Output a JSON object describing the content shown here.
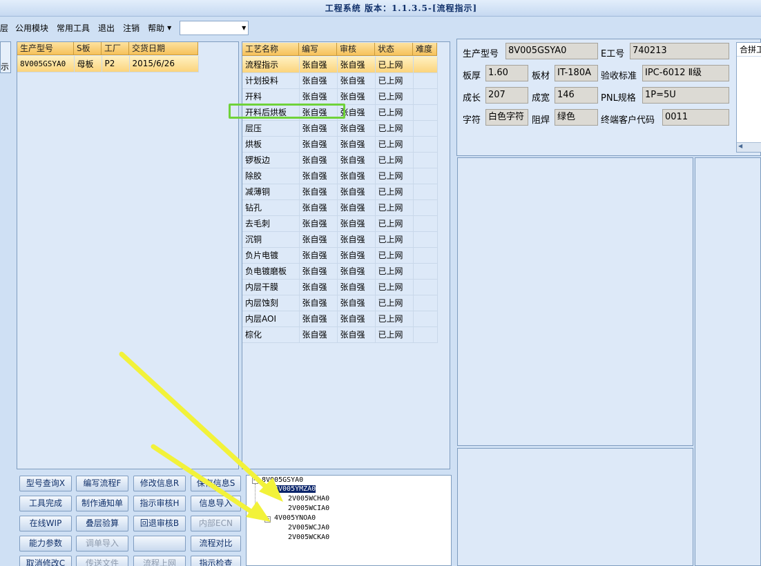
{
  "window": {
    "title": "工程系统 版本：1.1.3.5-[流程指示]"
  },
  "menu": {
    "items": [
      "公用模块",
      "常用工具",
      "退出",
      "注销",
      "帮助"
    ],
    "left_stub": "层",
    "combo_value": ""
  },
  "left_stub": {
    "label": "示"
  },
  "orders": {
    "headers": [
      "生产型号",
      "S板",
      "工厂",
      "交货日期"
    ],
    "rows": [
      [
        "8V005GSYA0",
        "母板",
        "P2",
        "2015/6/26"
      ]
    ]
  },
  "process": {
    "headers": [
      "工艺名称",
      "编写",
      "审核",
      "状态",
      "难度"
    ],
    "rows": [
      [
        "流程指示",
        "张自强",
        "张自强",
        "已上网",
        ""
      ],
      [
        "计划投料",
        "张自强",
        "张自强",
        "已上网",
        ""
      ],
      [
        "开料",
        "张自强",
        "张自强",
        "已上网",
        ""
      ],
      [
        "开料后烘板",
        "张自强",
        "张自强",
        "已上网",
        ""
      ],
      [
        "层压",
        "张自强",
        "张自强",
        "已上网",
        ""
      ],
      [
        "烘板",
        "张自强",
        "张自强",
        "已上网",
        ""
      ],
      [
        "锣板边",
        "张自强",
        "张自强",
        "已上网",
        ""
      ],
      [
        "除胶",
        "张自强",
        "张自强",
        "已上网",
        ""
      ],
      [
        "减薄铜",
        "张自强",
        "张自强",
        "已上网",
        ""
      ],
      [
        "钻孔",
        "张自强",
        "张自强",
        "已上网",
        ""
      ],
      [
        "去毛刺",
        "张自强",
        "张自强",
        "已上网",
        ""
      ],
      [
        "沉铜",
        "张自强",
        "张自强",
        "已上网",
        ""
      ],
      [
        "负片电镀",
        "张自强",
        "张自强",
        "已上网",
        ""
      ],
      [
        "负电镀磨板",
        "张自强",
        "张自强",
        "已上网",
        ""
      ],
      [
        "内层干膜",
        "张自强",
        "张自强",
        "已上网",
        ""
      ],
      [
        "内层蚀刻",
        "张自强",
        "张自强",
        "已上网",
        ""
      ],
      [
        "内层AOI",
        "张自强",
        "张自强",
        "已上网",
        ""
      ],
      [
        "棕化",
        "张自强",
        "张自强",
        "已上网",
        ""
      ]
    ]
  },
  "info": {
    "model_label": "生产型号",
    "model_value": "8V005GSYA0",
    "eno_label": "E工号",
    "eno_value": "740213",
    "thick_label": "板厚",
    "thick_value": "1.60",
    "mat_label": "板材",
    "mat_value": "IT-180A",
    "std_label": "验收标准",
    "std_value": "IPC-6012 Ⅱ级",
    "len_label": "成长",
    "len_value": "207",
    "wid_label": "成宽",
    "wid_value": "146",
    "pnl_label": "PNL规格",
    "pnl_value": "1P=5U",
    "char_label": "字符",
    "char_value": "白色字符",
    "mask_label": "阻焊",
    "mask_value": "绿色",
    "cust_label": "终端客户代码",
    "cust_value": "0011"
  },
  "side": {
    "title": "合拼工"
  },
  "buttons": [
    {
      "label": "型号查询X",
      "enabled": true
    },
    {
      "label": "编写流程F",
      "enabled": true
    },
    {
      "label": "修改信息R",
      "enabled": true
    },
    {
      "label": "保存信息S",
      "enabled": true
    },
    {
      "label": "工具完成",
      "enabled": true
    },
    {
      "label": "制作通知单",
      "enabled": true
    },
    {
      "label": "指示审核H",
      "enabled": true
    },
    {
      "label": "信息导入",
      "enabled": true
    },
    {
      "label": "在线WIP",
      "enabled": true
    },
    {
      "label": "叠层验算",
      "enabled": true
    },
    {
      "label": "回退审核B",
      "enabled": true
    },
    {
      "label": "内部ECN",
      "enabled": false
    },
    {
      "label": "能力参数",
      "enabled": true
    },
    {
      "label": "调单导入",
      "enabled": false
    },
    {
      "label": "",
      "enabled": true
    },
    {
      "label": "流程对比",
      "enabled": true
    },
    {
      "label": "取消修改C",
      "enabled": true
    },
    {
      "label": "传送文件",
      "enabled": false
    },
    {
      "label": "流程上网",
      "enabled": false
    },
    {
      "label": "指示检查",
      "enabled": true
    }
  ],
  "tree": {
    "root": "8V005GSYA0",
    "nodes": [
      {
        "label": "4V005YMZA0",
        "selected": true
      },
      {
        "label": "2V005WCHA0",
        "selected": false
      },
      {
        "label": "2V005WCIA0",
        "selected": false
      },
      {
        "label": "4V005YNOA0",
        "selected": false
      },
      {
        "label": "2V005WCJA0",
        "selected": false
      },
      {
        "label": "2V005WCKA0",
        "selected": false
      }
    ]
  },
  "colors": {
    "highlight": "#6fd23a",
    "arrow": "#f2f23a"
  }
}
